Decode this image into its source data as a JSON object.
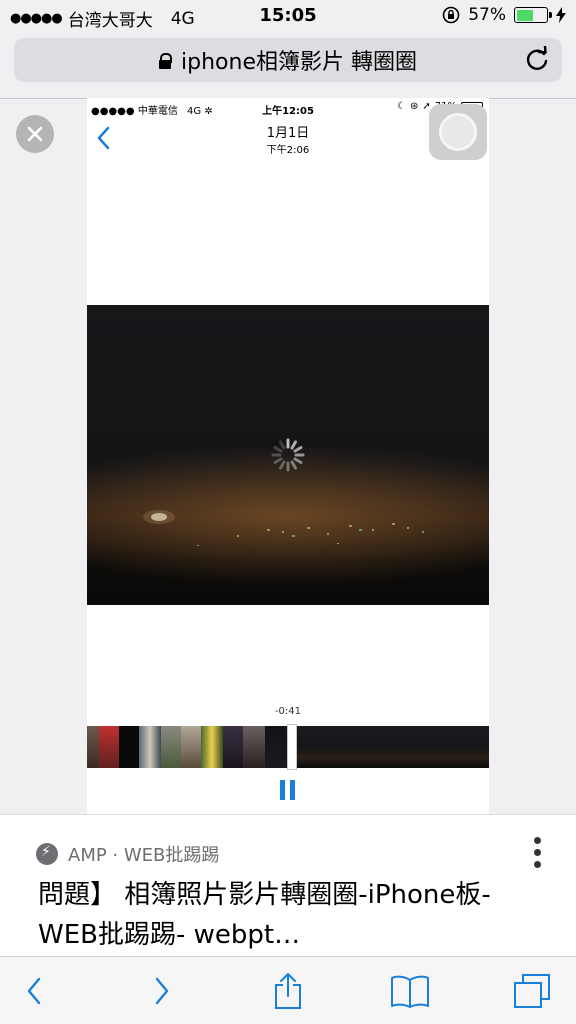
{
  "status": {
    "signal_dots": "●●●●●",
    "carrier": "台湾大哥大",
    "network": "4G",
    "time": "15:05",
    "battery_percent": "57%",
    "battery_level": 0.57
  },
  "urlbar": {
    "title": "iphone相簿影片 轉圈圈"
  },
  "inner_phone": {
    "signal_dots": "●●●●●",
    "carrier": "中華電信",
    "network": "4G",
    "time": "上午12:05",
    "battery_percent": "71%",
    "date": "1月1日",
    "subtime": "下午2:06",
    "timecode": "-0:41"
  },
  "result": {
    "source": "AMP · WEB批踢踢",
    "title": "問題】 相簿照片影片轉圈圈-iPhone板- WEB批踢踢- webpt…"
  },
  "colors": {
    "accent": "#1a7fdc",
    "battery_green": "#4cd964"
  }
}
